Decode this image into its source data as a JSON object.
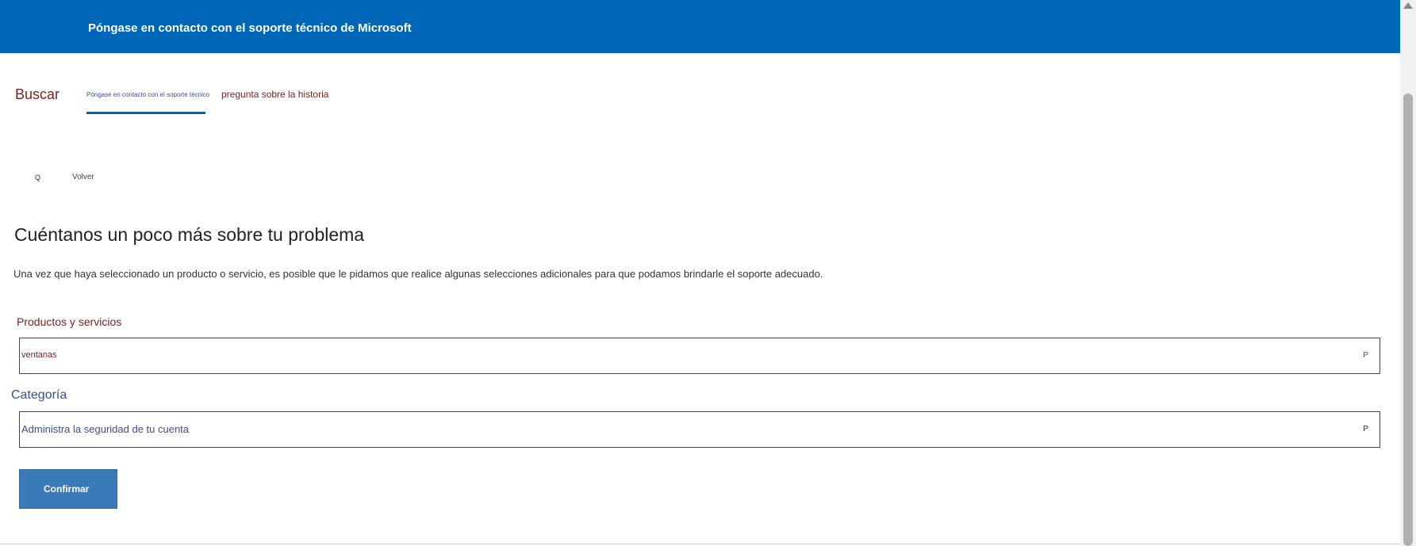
{
  "header": {
    "title": "Póngase en contacto con el soporte técnico de Microsoft"
  },
  "nav": {
    "search": "Buscar",
    "active_tab": "Póngase en contacto con el soporte técnico",
    "history_tab": "pregunta sobre la historia"
  },
  "back": {
    "icon_glyph": "Q",
    "icon": "search-icon",
    "label": "Volver"
  },
  "form": {
    "heading": "Cuéntanos un poco más sobre tu problema",
    "description": "Una vez que haya seleccionado un producto o servicio, es posible que le pidamos que realice algunas selecciones adicionales para que podamos brindarle el soporte adecuado.",
    "products_label": "Productos y servicios",
    "products_value": "ventanas",
    "products_chevron": "P",
    "category_label": "Categoría",
    "category_value": "Administra la seguridad de tu cuenta",
    "category_chevron": "P",
    "confirm_label": "Confirmar"
  },
  "colors": {
    "header_bg": "#0067b8",
    "link_red": "#7a2222",
    "link_blue": "#3a4d8f",
    "button_bg": "#3a7ab8"
  }
}
